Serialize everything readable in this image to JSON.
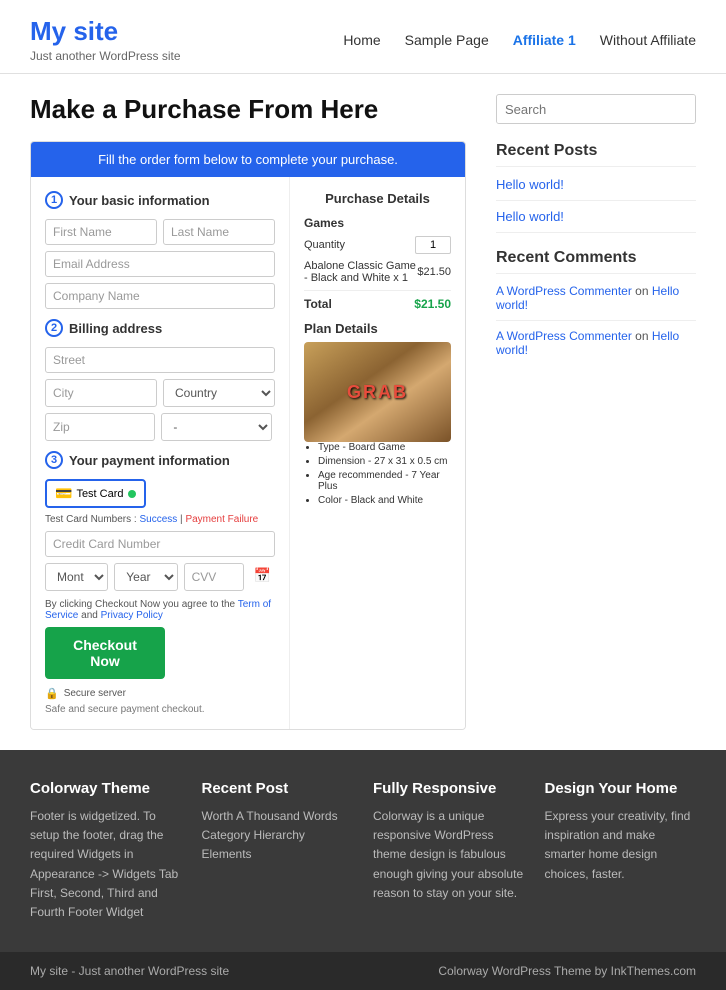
{
  "site": {
    "title": "My site",
    "tagline": "Just another WordPress site"
  },
  "nav": {
    "items": [
      {
        "label": "Home",
        "active": false
      },
      {
        "label": "Sample Page",
        "active": false
      },
      {
        "label": "Affiliate 1",
        "active": true
      },
      {
        "label": "Without Affiliate",
        "active": false
      }
    ]
  },
  "page": {
    "title": "Make a Purchase From Here"
  },
  "checkout": {
    "header": "Fill the order form below to complete your purchase.",
    "section1": "Your basic information",
    "section2": "Billing address",
    "section3": "Your payment information",
    "fields": {
      "first_name": "First Name",
      "last_name": "Last Name",
      "email": "Email Address",
      "company": "Company Name",
      "street": "Street",
      "city": "City",
      "country": "Country",
      "zip": "Zip"
    },
    "payment_method": "Test Card",
    "test_card_label": "Test Card Numbers :",
    "success_link": "Success",
    "failure_link": "Payment Failure",
    "cc_placeholder": "Credit Card Number",
    "month_placeholder": "Month",
    "year_placeholder": "Year",
    "cvv_placeholder": "CVV",
    "terms_text": "By clicking Checkout Now you agree to the",
    "terms_link": "Term of Service",
    "privacy_link": "Privacy Policy",
    "checkout_btn": "Checkout Now",
    "secure_label": "Secure server",
    "secure_sub": "Safe and secure payment checkout."
  },
  "order": {
    "title": "Purchase Details",
    "section_label": "Games",
    "quantity_label": "Quantity",
    "quantity_value": "1",
    "item_name": "Abalone Classic Game - Black and White x 1",
    "item_price": "$21.50",
    "total_label": "Total",
    "total_value": "$21.50",
    "plan_title": "Plan Details",
    "product_name": "GRAB",
    "product_details": [
      "Type - Board Game",
      "Dimension - 27 x 31 x 0.5 cm",
      "Age recommended - 7 Year Plus",
      "Color - Black and White"
    ]
  },
  "sidebar": {
    "search_placeholder": "Search",
    "recent_posts_title": "Recent Posts",
    "posts": [
      {
        "label": "Hello world!"
      },
      {
        "label": "Hello world!"
      }
    ],
    "recent_comments_title": "Recent Comments",
    "comments": [
      {
        "author": "A WordPress Commenter",
        "on": "on",
        "post": "Hello world!"
      },
      {
        "author": "A WordPress Commenter",
        "on": "on",
        "post": "Hello world!"
      }
    ]
  },
  "footer": {
    "widgets": [
      {
        "title": "Colorway Theme",
        "text": "Footer is widgetized. To setup the footer, drag the required Widgets in Appearance -> Widgets Tab First, Second, Third and Fourth Footer Widget"
      },
      {
        "title": "Recent Post",
        "links": [
          "Worth A Thousand Words",
          "Category Hierarchy Elements"
        ]
      },
      {
        "title": "Fully Responsive",
        "text": "Colorway is a unique responsive WordPress theme design is fabulous enough giving your absolute reason to stay on your site."
      },
      {
        "title": "Design Your Home",
        "text": "Express your creativity, find inspiration and make smarter home design choices, faster."
      }
    ],
    "bar_left": "My site - Just another WordPress site",
    "bar_right": "Colorway WordPress Theme by InkThemes.com"
  }
}
